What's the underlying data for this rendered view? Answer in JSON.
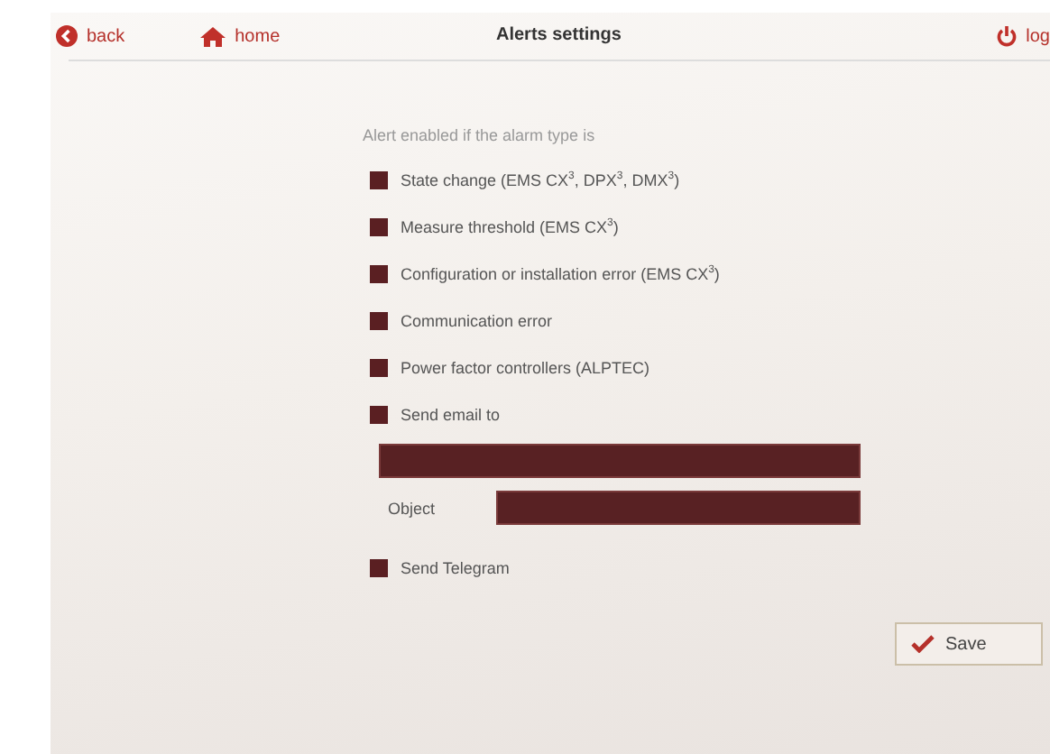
{
  "header": {
    "back": "back",
    "home": "home",
    "title": "Alerts settings",
    "logout": "log"
  },
  "intro": "Alert enabled if the alarm type is",
  "alarm_types": [
    {
      "label": "State change (EMS CX$^{3}$, DPX$^{3}$, DMX$^{3}$)",
      "checked": false
    },
    {
      "label": "Measure threshold (EMS CX$^{3}$)",
      "checked": false
    },
    {
      "label": "Configuration or installation error (EMS CX$^{3}$)",
      "checked": false
    },
    {
      "label": "Communication error",
      "checked": false
    },
    {
      "label": "Power factor controllers (ALPTEC)",
      "checked": false
    }
  ],
  "email": {
    "label": "Send email to",
    "checked": false,
    "object_label": "Object"
  },
  "telegram": {
    "label": "Send Telegram",
    "checked": false
  },
  "save": "Save"
}
